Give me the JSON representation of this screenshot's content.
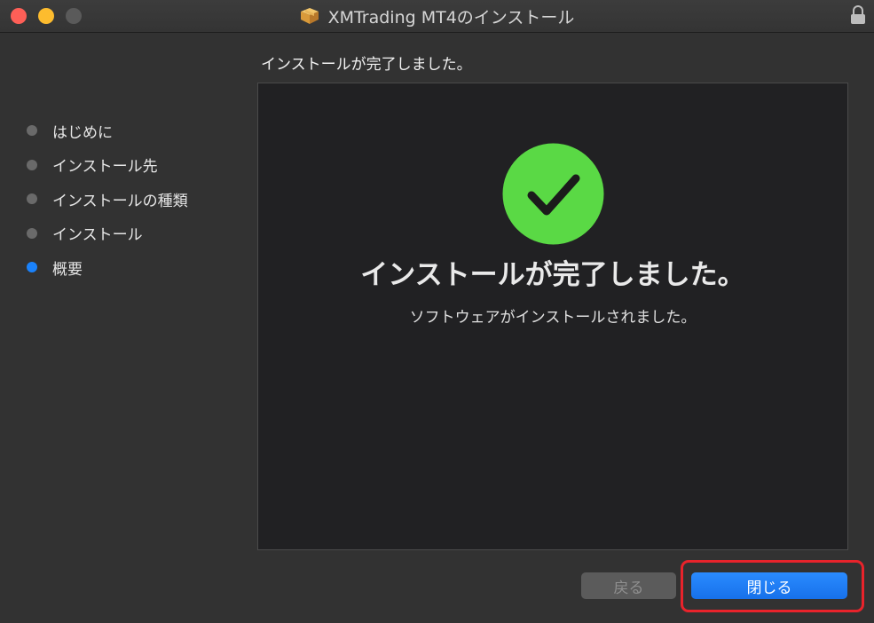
{
  "window": {
    "title": "XMTrading MT4のインストール"
  },
  "heading": "インストールが完了しました。",
  "steps": [
    {
      "label": "はじめに",
      "active": false
    },
    {
      "label": "インストール先",
      "active": false
    },
    {
      "label": "インストールの種類",
      "active": false
    },
    {
      "label": "インストール",
      "active": false
    },
    {
      "label": "概要",
      "active": true
    }
  ],
  "content": {
    "title": "インストールが完了しました。",
    "message": "ソフトウェアがインストールされました。"
  },
  "buttons": {
    "back": "戻る",
    "close": "閉じる"
  },
  "colors": {
    "accent": "#1a82fb",
    "success": "#5ad945",
    "annotation_outline": "#e8232b"
  }
}
